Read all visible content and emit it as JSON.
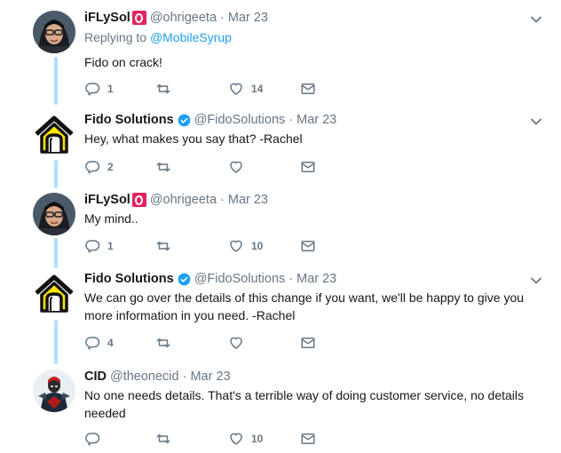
{
  "tweets": [
    {
      "name": "iFLySol",
      "handle": "@ohrigeeta",
      "date": "Mar 23",
      "replying_prefix": "Replying to ",
      "replying_mention": "@MobileSyrup",
      "text": "Fido on crack!",
      "replies": "1",
      "retweets": "",
      "likes": "14"
    },
    {
      "name": "Fido Solutions",
      "handle": "@FidoSolutions",
      "date": "Mar 23",
      "text": "Hey, what makes you say that? -Rachel",
      "replies": "2",
      "retweets": "",
      "likes": ""
    },
    {
      "name": "iFLySol",
      "handle": "@ohrigeeta",
      "date": "Mar 23",
      "text": "My mind..",
      "replies": "1",
      "retweets": "",
      "likes": "10"
    },
    {
      "name": "Fido Solutions",
      "handle": "@FidoSolutions",
      "date": "Mar 23",
      "text": "We can go over the details of this change if you want, we'll be happy to give you more information in you need. -Rachel",
      "replies": "4",
      "retweets": "",
      "likes": ""
    },
    {
      "name": "CID",
      "handle": "@theonecid",
      "date": "Mar 23",
      "text": "No one needs details. That's a terrible way of doing customer service, no details needed",
      "replies": "",
      "retweets": "",
      "likes": "10"
    }
  ],
  "separator": "·",
  "colors": {
    "accent": "#1da1f2",
    "thread_line": "#aedff9",
    "muted": "#657786",
    "fido_yellow": "#ffe600"
  }
}
